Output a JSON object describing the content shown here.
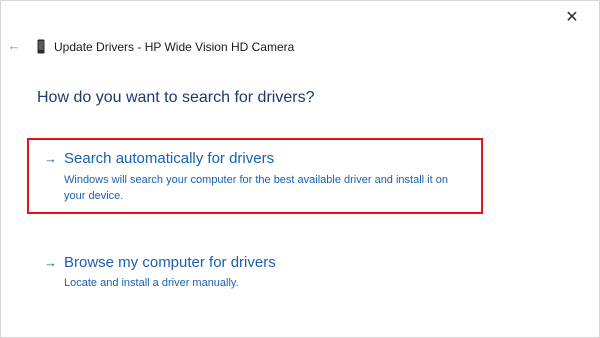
{
  "window": {
    "title": "Update Drivers - HP Wide Vision HD Camera",
    "back_icon": "←",
    "close_icon": "✕"
  },
  "heading": "How do you want to search for drivers?",
  "options": [
    {
      "arrow": "→",
      "title": "Search automatically for drivers",
      "description": "Windows will search your computer for the best available driver and install it on your device.",
      "highlighted": true
    },
    {
      "arrow": "→",
      "title": "Browse my computer for drivers",
      "description": "Locate and install a driver manually.",
      "highlighted": false
    }
  ],
  "colors": {
    "link": "#1a5fb4",
    "heading": "#1e3a6e",
    "highlight_border": "#e0141e"
  }
}
